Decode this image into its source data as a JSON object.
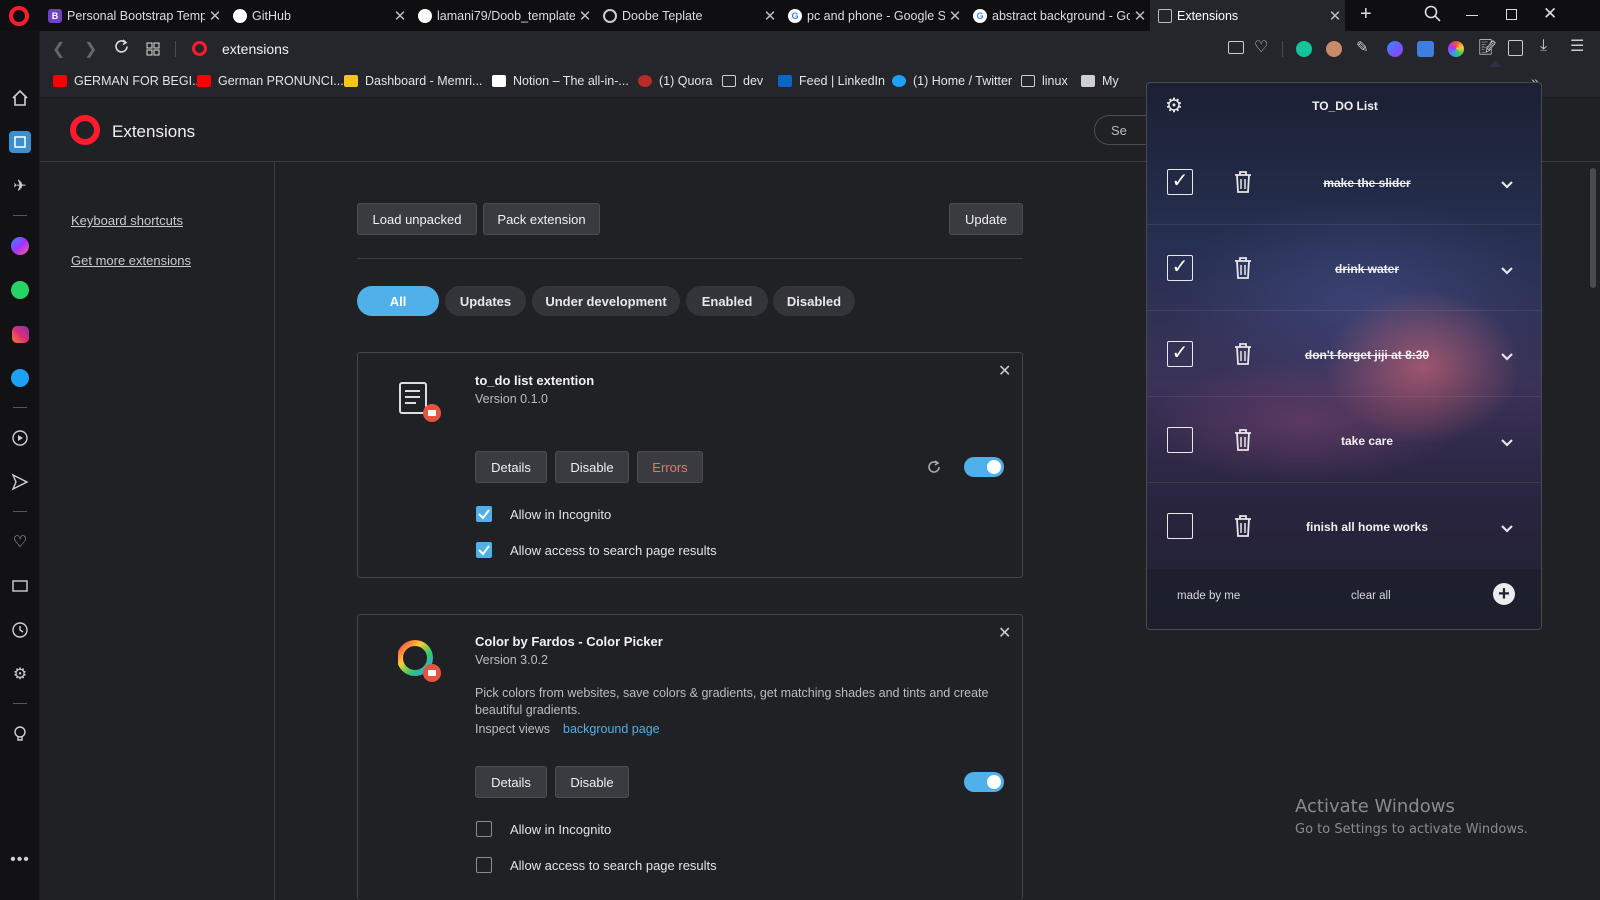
{
  "tabs": [
    {
      "title": "Personal Bootstrap Template",
      "fav_text": "B",
      "fav_color": "#6f42c1"
    },
    {
      "title": "GitHub",
      "fav_text": "",
      "fav_color": "#ffffff"
    },
    {
      "title": "lamani79/Doob_template",
      "fav_text": "",
      "fav_color": "#ffffff"
    },
    {
      "title": "Doobe Teplate",
      "fav_text": "",
      "fav_color": "#cccccc"
    },
    {
      "title": "pc and phone - Google Search",
      "fav_text": "G",
      "fav_color": "#ffffff"
    },
    {
      "title": "abstract background - Google Search",
      "fav_text": "G",
      "fav_color": "#ffffff"
    },
    {
      "title": "Extensions",
      "fav_text": "",
      "fav_color": "#bbbbbb"
    }
  ],
  "address": {
    "url": "extensions"
  },
  "bookmarks": [
    {
      "label": "GERMAN FOR BEGI...",
      "icon": "youtube-icon",
      "color": "#ff0000"
    },
    {
      "label": "German PRONUNCI...",
      "icon": "youtube-icon",
      "color": "#ff0000"
    },
    {
      "label": "Dashboard - Memri...",
      "icon": "memrise-icon",
      "color": "#f5c518"
    },
    {
      "label": "Notion – The all-in-...",
      "icon": "notion-icon",
      "color": "#ffffff"
    },
    {
      "label": "(1) Quora",
      "icon": "quora-icon",
      "color": "#b92b27"
    },
    {
      "label": "dev",
      "icon": "folder-icon",
      "color": "#cfcfcf"
    },
    {
      "label": "Feed | LinkedIn",
      "icon": "linkedin-icon",
      "color": "#0a66c2"
    },
    {
      "label": "(1) Home / Twitter",
      "icon": "twitter-icon",
      "color": "#1da1f2"
    },
    {
      "label": "linux",
      "icon": "folder-icon",
      "color": "#cfcfcf"
    },
    {
      "label": "My",
      "icon": "page-icon",
      "color": "#cfcfcf"
    }
  ],
  "page": {
    "title": "Extensions",
    "search_partial": "Se",
    "nav": {
      "keyboard_shortcuts": "Keyboard shortcuts",
      "get_more": "Get more extensions"
    },
    "toolbar": {
      "load_unpacked": "Load unpacked",
      "pack_extension": "Pack extension",
      "update": "Update"
    },
    "filters": [
      "All",
      "Updates",
      "Under development",
      "Enabled",
      "Disabled"
    ],
    "extensions": [
      {
        "name": "to_do list extention",
        "version": "Version 0.1.0",
        "details": "Details",
        "disable": "Disable",
        "errors": "Errors",
        "enabled": true,
        "allow_incognito": "Allow in Incognito",
        "incognito_checked": true,
        "allow_search": "Allow access to search page results",
        "search_checked": true
      },
      {
        "name": "Color by Fardos - Color Picker",
        "version": "Version 3.0.2",
        "description": "Pick colors from websites, save colors & gradients, get matching shades and tints and create beautiful gradients.",
        "inspect_label": "Inspect views",
        "inspect_link": "background page",
        "details": "Details",
        "disable": "Disable",
        "enabled": true,
        "allow_incognito": "Allow in Incognito",
        "incognito_checked": false,
        "allow_search": "Allow access to search page results",
        "search_checked": false
      }
    ]
  },
  "popup": {
    "title": "TO_DO List",
    "items": [
      {
        "text": "make the slider",
        "done": true
      },
      {
        "text": "drink water",
        "done": true
      },
      {
        "text": "don't forget jiji at 8:30",
        "done": true
      },
      {
        "text": "take care",
        "done": false
      },
      {
        "text": "finish all home works",
        "done": false
      }
    ],
    "footer": {
      "made_by": "made by me",
      "clear_all": "clear all"
    }
  },
  "watermark": {
    "line1": "Activate Windows",
    "line2": "Go to Settings to activate Windows."
  },
  "colors": {
    "accent": "#4fb0ea",
    "opera_red": "#ff1b2d",
    "errors_text": "#e8756b"
  }
}
